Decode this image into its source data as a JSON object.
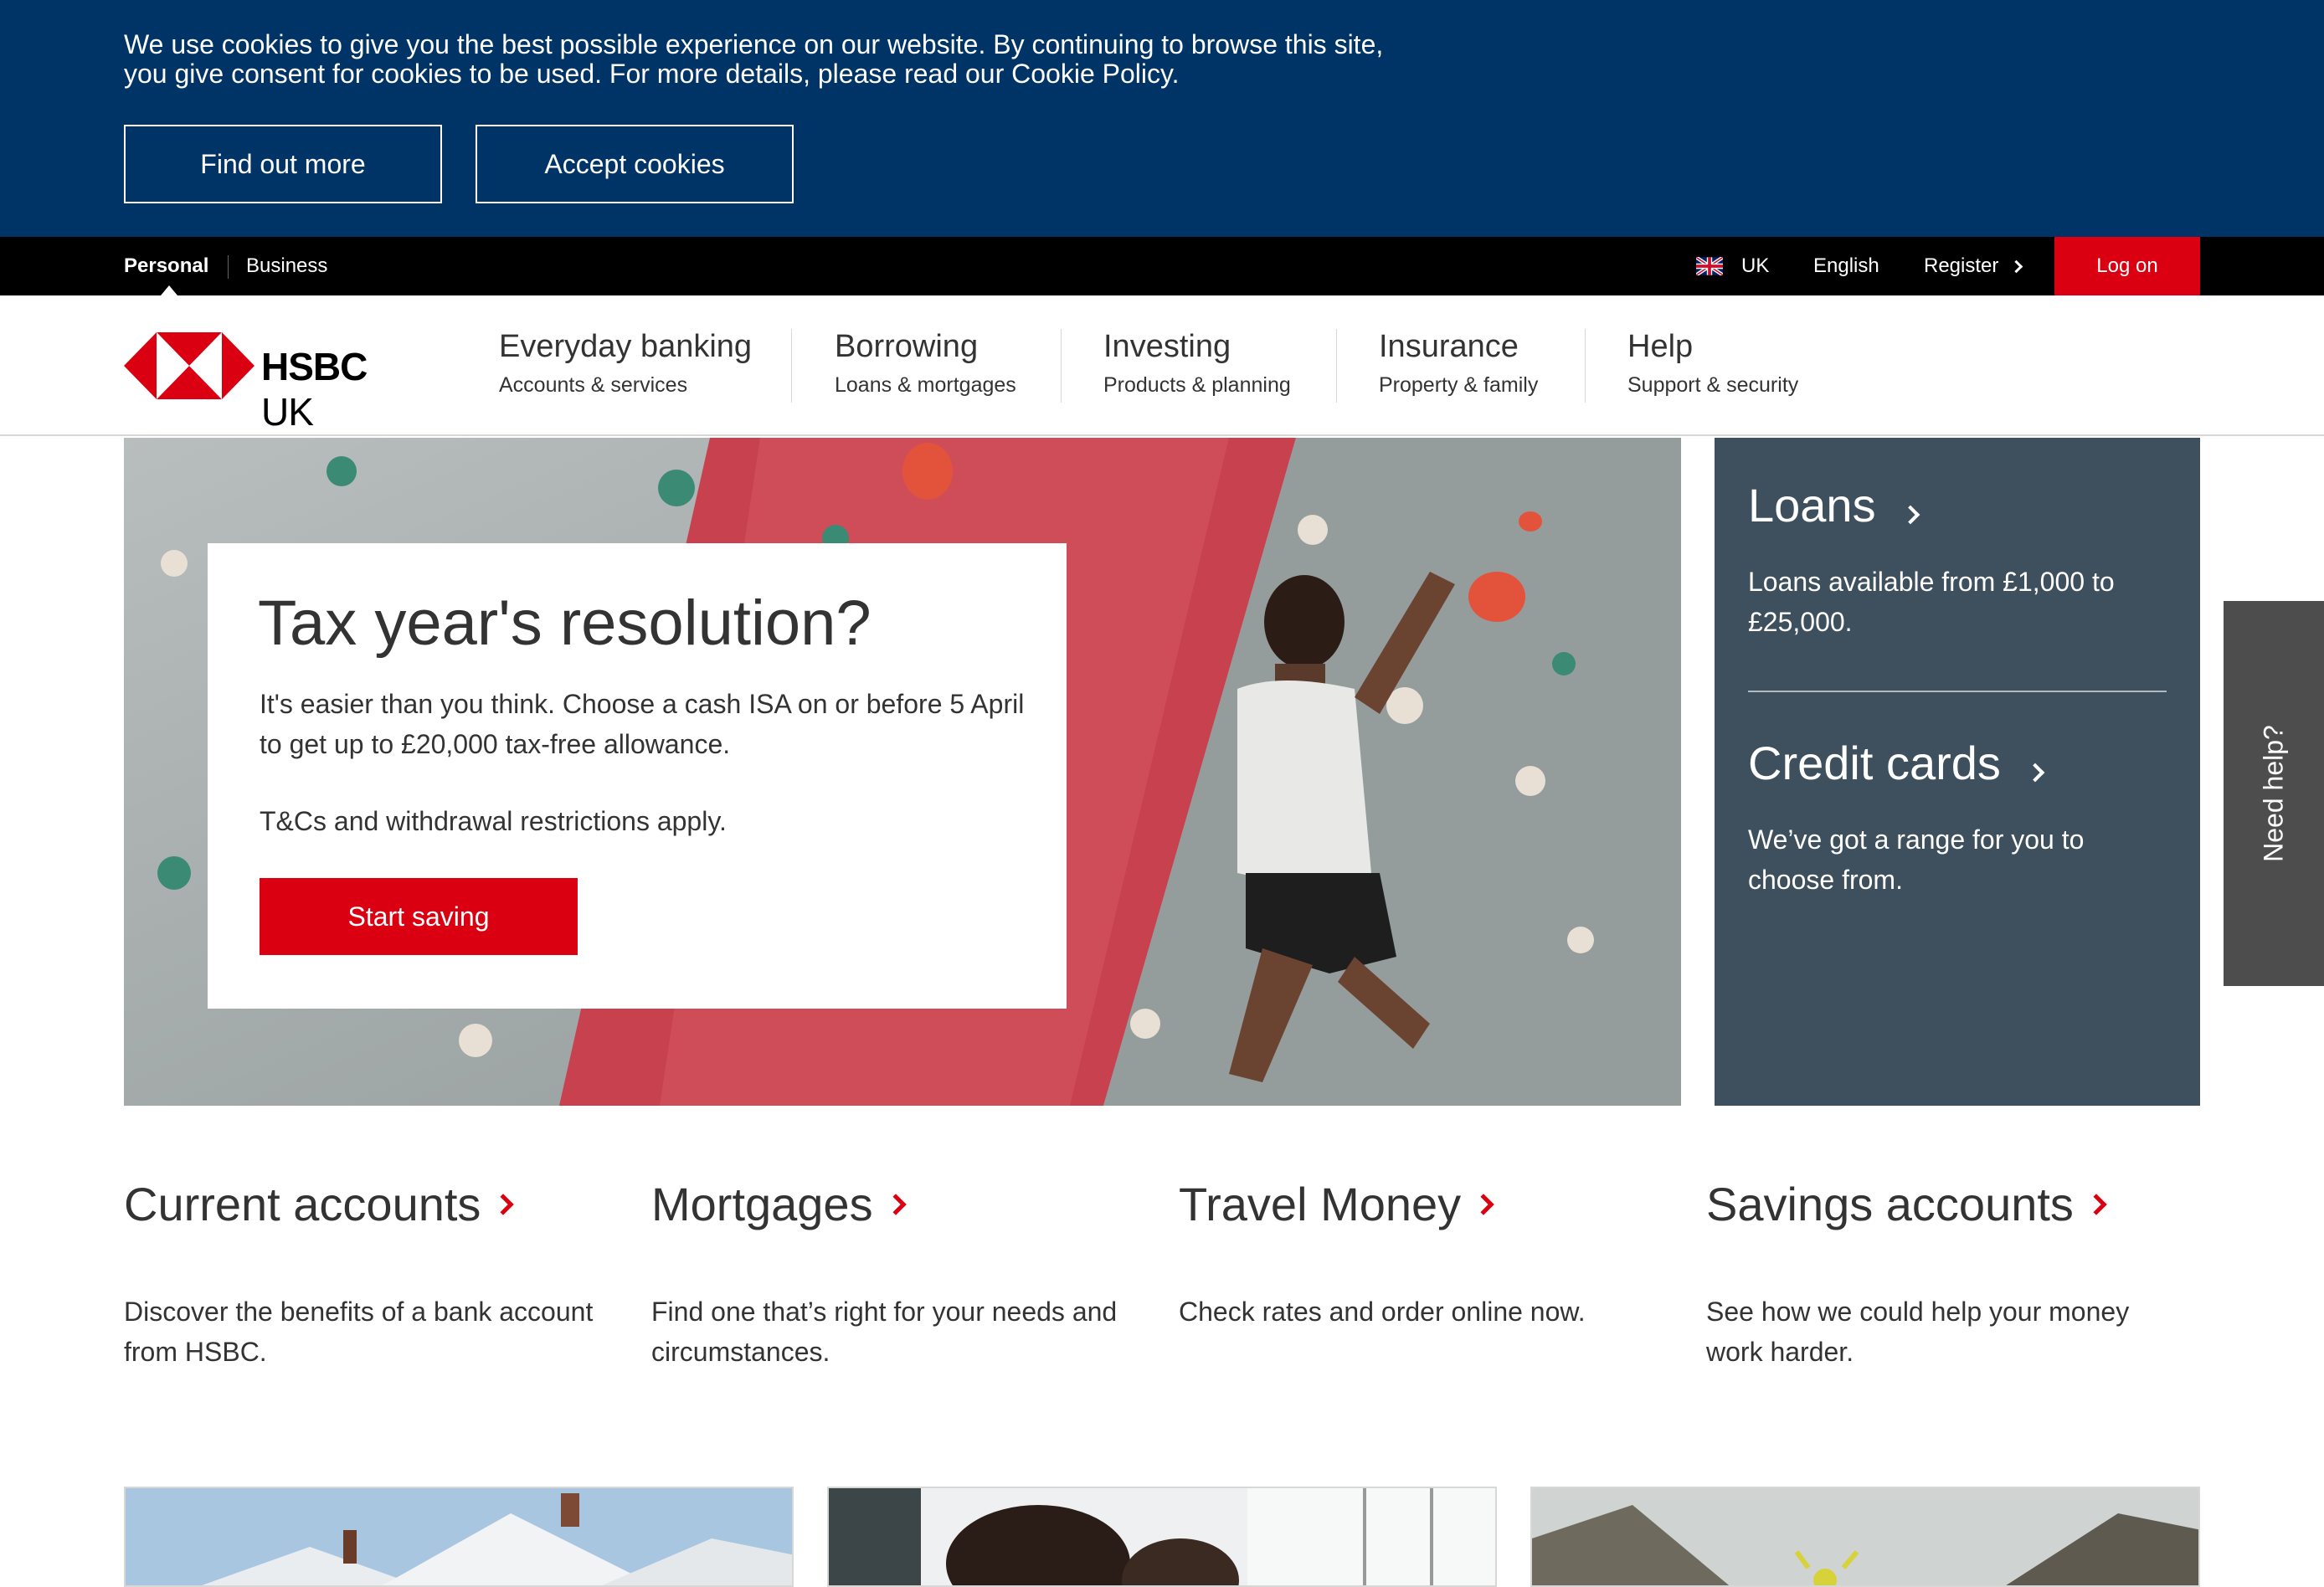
{
  "cookie_banner": {
    "text_line1": "We use cookies to give you the best possible experience on our website. By continuing to browse this site,",
    "text_line2": "you give consent for cookies to be used. For more details, please read our Cookie Policy.",
    "find_out_more": "Find out more",
    "accept_cookies": "Accept cookies"
  },
  "topbar": {
    "personal": "Personal",
    "business": "Business",
    "country": "UK",
    "language": "English",
    "register": "Register",
    "log_on": "Log on"
  },
  "logo": {
    "brand": "HSBC",
    "suffix": "UK"
  },
  "nav": [
    {
      "title": "Everyday banking",
      "subtitle": "Accounts & services"
    },
    {
      "title": "Borrowing",
      "subtitle": "Loans & mortgages"
    },
    {
      "title": "Investing",
      "subtitle": "Products & planning"
    },
    {
      "title": "Insurance",
      "subtitle": "Property & family"
    },
    {
      "title": "Help",
      "subtitle": "Support & security"
    }
  ],
  "hero": {
    "title": "Tax year's resolution?",
    "description": "It's easier than you think. Choose a cash ISA on or before 5 April to get up to £20,000 tax-free allowance.",
    "terms": "T&Cs and withdrawal restrictions apply.",
    "cta": "Start saving"
  },
  "side_panel": {
    "loans_title": "Loans",
    "loans_desc": "Loans available from £1,000 to £25,000.",
    "cards_title": "Credit cards",
    "cards_desc": "We’ve got a range for you to choose from."
  },
  "need_help": "Need help?",
  "products": [
    {
      "title": "Current accounts",
      "desc": "Discover the benefits of a bank account from HSBC."
    },
    {
      "title": "Mortgages",
      "desc": "Find one that’s right for your needs and circumstances."
    },
    {
      "title": "Travel Money",
      "desc": "Check rates and order online now."
    },
    {
      "title": "Savings accounts",
      "desc": "See how we could help your money work harder."
    }
  ],
  "colors": {
    "brand_red": "#db0011",
    "banner_blue": "#003366",
    "panel_slate": "#3e505d"
  }
}
